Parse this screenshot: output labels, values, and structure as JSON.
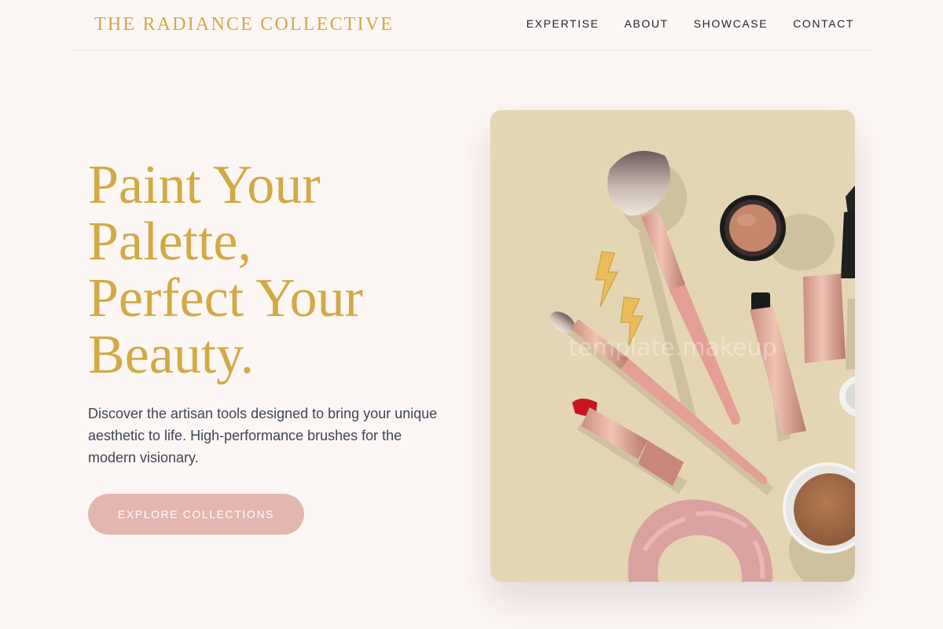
{
  "brand": {
    "name": "THE RADIANCE COLLECTIVE"
  },
  "nav": {
    "items": [
      "EXPERTISE",
      "ABOUT",
      "SHOWCASE",
      "CONTACT"
    ]
  },
  "hero": {
    "title_lines": [
      "Paint Your",
      "Palette,",
      "Perfect Your",
      "Beauty."
    ],
    "description": "Discover the artisan tools designed to bring your unique aesthetic to life. High-performance brushes for the modern visionary.",
    "cta_label": "EXPLORE COLLECTIONS"
  },
  "image": {
    "watermark": "template.makeup",
    "subject": "flat-lay of makeup brushes, lipstick, mascara, compact powders and a velvet scrunchie"
  },
  "colors": {
    "page_background": "#fcf6f5",
    "accent_gold": "#d1aa44",
    "cta_pink": "#e3b7b0",
    "photo_background": "#e4d6b3",
    "body_text": "#3f4554"
  }
}
